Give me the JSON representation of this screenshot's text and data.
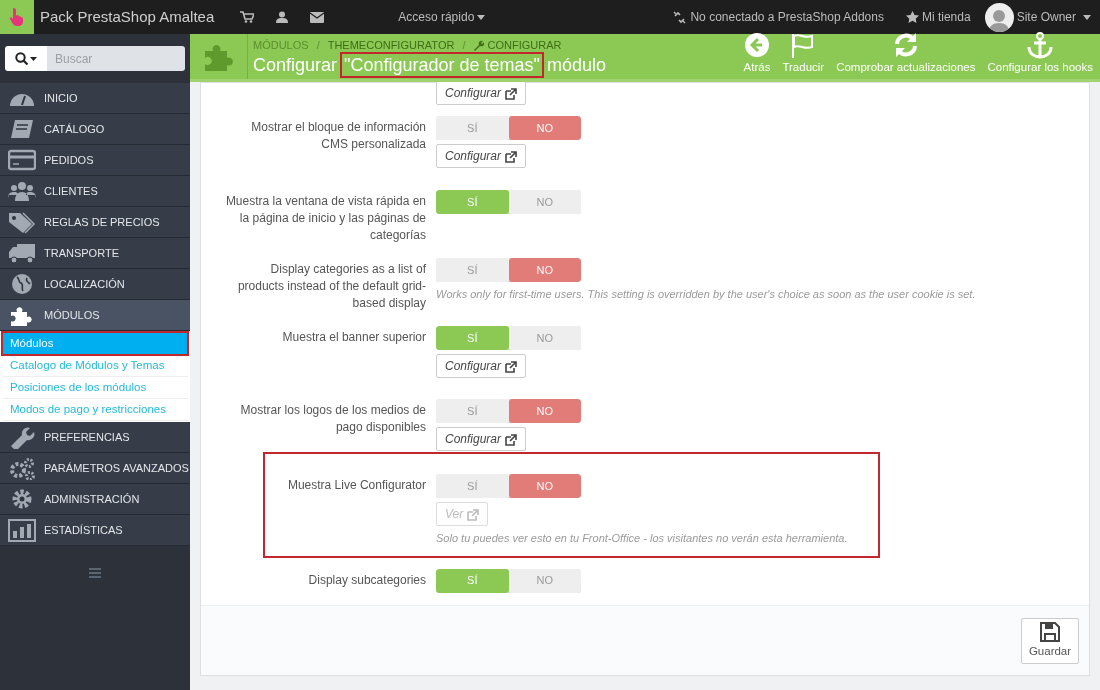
{
  "topbar": {
    "shop_name": "Pack PrestaShop Amaltea",
    "quick_access": "Acceso rápido",
    "addons_status": "No conectado a PrestaShop Addons",
    "my_shop": "Mi tienda",
    "user": "Site Owner"
  },
  "sidebar": {
    "search": {
      "placeholder": "Buscar"
    },
    "items": [
      {
        "label": "INICIO",
        "selected": false
      },
      {
        "label": "CATÁLOGO",
        "selected": false
      },
      {
        "label": "PEDIDOS",
        "selected": false
      },
      {
        "label": "CLIENTES",
        "selected": false
      },
      {
        "label": "REGLAS DE PRECIOS",
        "selected": false
      },
      {
        "label": "TRANSPORTE",
        "selected": false
      },
      {
        "label": "LOCALIZACIÓN",
        "selected": false
      },
      {
        "label": "MÓDULOS",
        "selected": true,
        "children": [
          {
            "label": "Módulos",
            "selected": true,
            "highlighted": true
          },
          {
            "label": "Catalogo de Módulos y Temas",
            "selected": false,
            "highlighted": false
          },
          {
            "label": "Posiciones de los módulos",
            "selected": false,
            "highlighted": false
          },
          {
            "label": "Modos de pago y restricciones",
            "selected": false,
            "highlighted": false
          }
        ]
      },
      {
        "label": "PREFERENCIAS",
        "selected": false
      },
      {
        "label": "PARÁMETROS AVANZADOS",
        "selected": false
      },
      {
        "label": "ADMINISTRACIÓN",
        "selected": false
      },
      {
        "label": "ESTADÍSTICAS",
        "selected": false
      }
    ]
  },
  "header": {
    "breadcrumb": [
      "MÓDULOS",
      "THEMECONFIGURATOR",
      "CONFIGURAR"
    ],
    "separator": "/",
    "title": [
      {
        "text": "Configurar",
        "highlighted": false
      },
      {
        "text": "\"Configurador de temas\"",
        "highlighted": true
      },
      {
        "text": "módulo",
        "highlighted": false
      }
    ],
    "toolbar": [
      "Atrás",
      "Traducir",
      "Comprobar actualizaciones",
      "Configurar los hooks"
    ]
  },
  "settings": [
    {
      "button": {
        "label": "Configurar",
        "disabled": false
      }
    },
    {
      "label": "Mostrar el bloque de información CMS personalizada",
      "options": [
        {
          "label": "SÍ",
          "selected": false
        },
        {
          "label": "NO",
          "selected": true
        }
      ],
      "button": {
        "label": "Configurar",
        "disabled": false
      }
    },
    {
      "label": "Muestra la ventana de vista rápida en la página de inicio y las páginas de categorías",
      "options": [
        {
          "label": "SÍ",
          "selected": true
        },
        {
          "label": "NO",
          "selected": false
        }
      ]
    },
    {
      "label": "Display categories as a list of products instead of the default grid-based display",
      "options": [
        {
          "label": "SÍ",
          "selected": false
        },
        {
          "label": "NO",
          "selected": true
        }
      ],
      "help": "Works only for first-time users. This setting is overridden by the user's choice as soon as the user cookie is set."
    },
    {
      "label": "Muestra el banner superior",
      "options": [
        {
          "label": "SÍ",
          "selected": true
        },
        {
          "label": "NO",
          "selected": false
        }
      ],
      "button": {
        "label": "Configurar",
        "disabled": false
      }
    },
    {
      "label": "Mostrar los logos de los medios de pago disponibles",
      "options": [
        {
          "label": "SÍ",
          "selected": false
        },
        {
          "label": "NO",
          "selected": true
        }
      ],
      "button": {
        "label": "Configurar",
        "disabled": false
      }
    },
    {
      "label": "Muestra Live Configurator",
      "highlighted": true,
      "options": [
        {
          "label": "SÍ",
          "selected": false
        },
        {
          "label": "NO",
          "selected": true
        }
      ],
      "button": {
        "label": "Ver",
        "disabled": true
      },
      "help": "Solo tu puedes ver esto en tu Front-Office - los visitantes no verán esta herramienta."
    },
    {
      "label": "Display subcategories",
      "options": [
        {
          "label": "SÍ",
          "selected": true
        },
        {
          "label": "NO",
          "selected": false
        }
      ]
    }
  ],
  "save_button": "Guardar"
}
